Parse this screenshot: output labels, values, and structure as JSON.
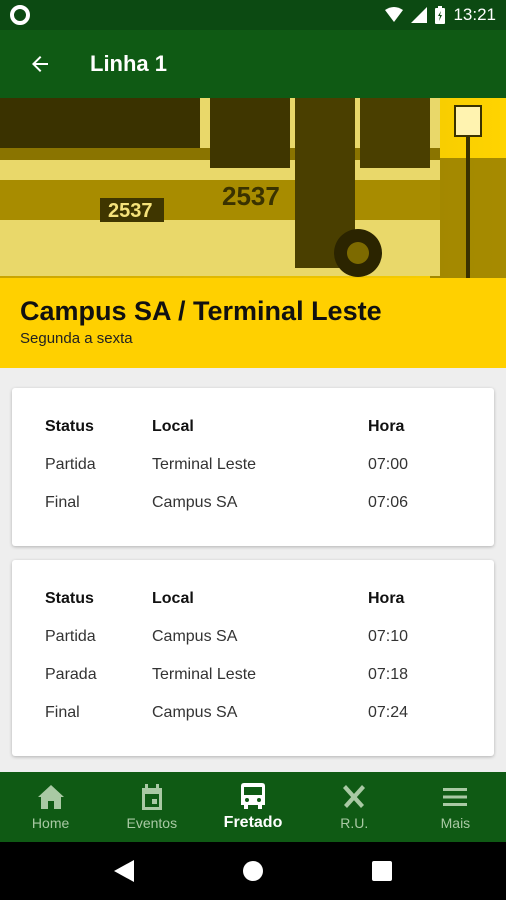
{
  "status_bar": {
    "time": "13:21"
  },
  "app_bar": {
    "title": "Linha 1"
  },
  "route": {
    "name": "Campus SA / Terminal Leste",
    "days": "Segunda a sexta"
  },
  "hero_image": {
    "bus_number": "2537"
  },
  "columns": {
    "status": "Status",
    "local": "Local",
    "hora": "Hora"
  },
  "trips": [
    {
      "stops": [
        {
          "status": "Partida",
          "local": "Terminal Leste",
          "hora": "07:00"
        },
        {
          "status": "Final",
          "local": "Campus SA",
          "hora": "07:06"
        }
      ]
    },
    {
      "stops": [
        {
          "status": "Partida",
          "local": "Campus SA",
          "hora": "07:10"
        },
        {
          "status": "Parada",
          "local": "Terminal Leste",
          "hora": "07:18"
        },
        {
          "status": "Final",
          "local": "Campus SA",
          "hora": "07:24"
        }
      ]
    }
  ],
  "bottom_nav": [
    {
      "label": "Home",
      "icon": "home-icon"
    },
    {
      "label": "Eventos",
      "icon": "calendar-icon"
    },
    {
      "label": "Fretado",
      "icon": "bus-icon",
      "active": true
    },
    {
      "label": "R.U.",
      "icon": "restaurant-icon"
    },
    {
      "label": "Mais",
      "icon": "menu-icon"
    }
  ],
  "colors": {
    "primary": "#0f5a14",
    "accent": "#ffd000"
  }
}
